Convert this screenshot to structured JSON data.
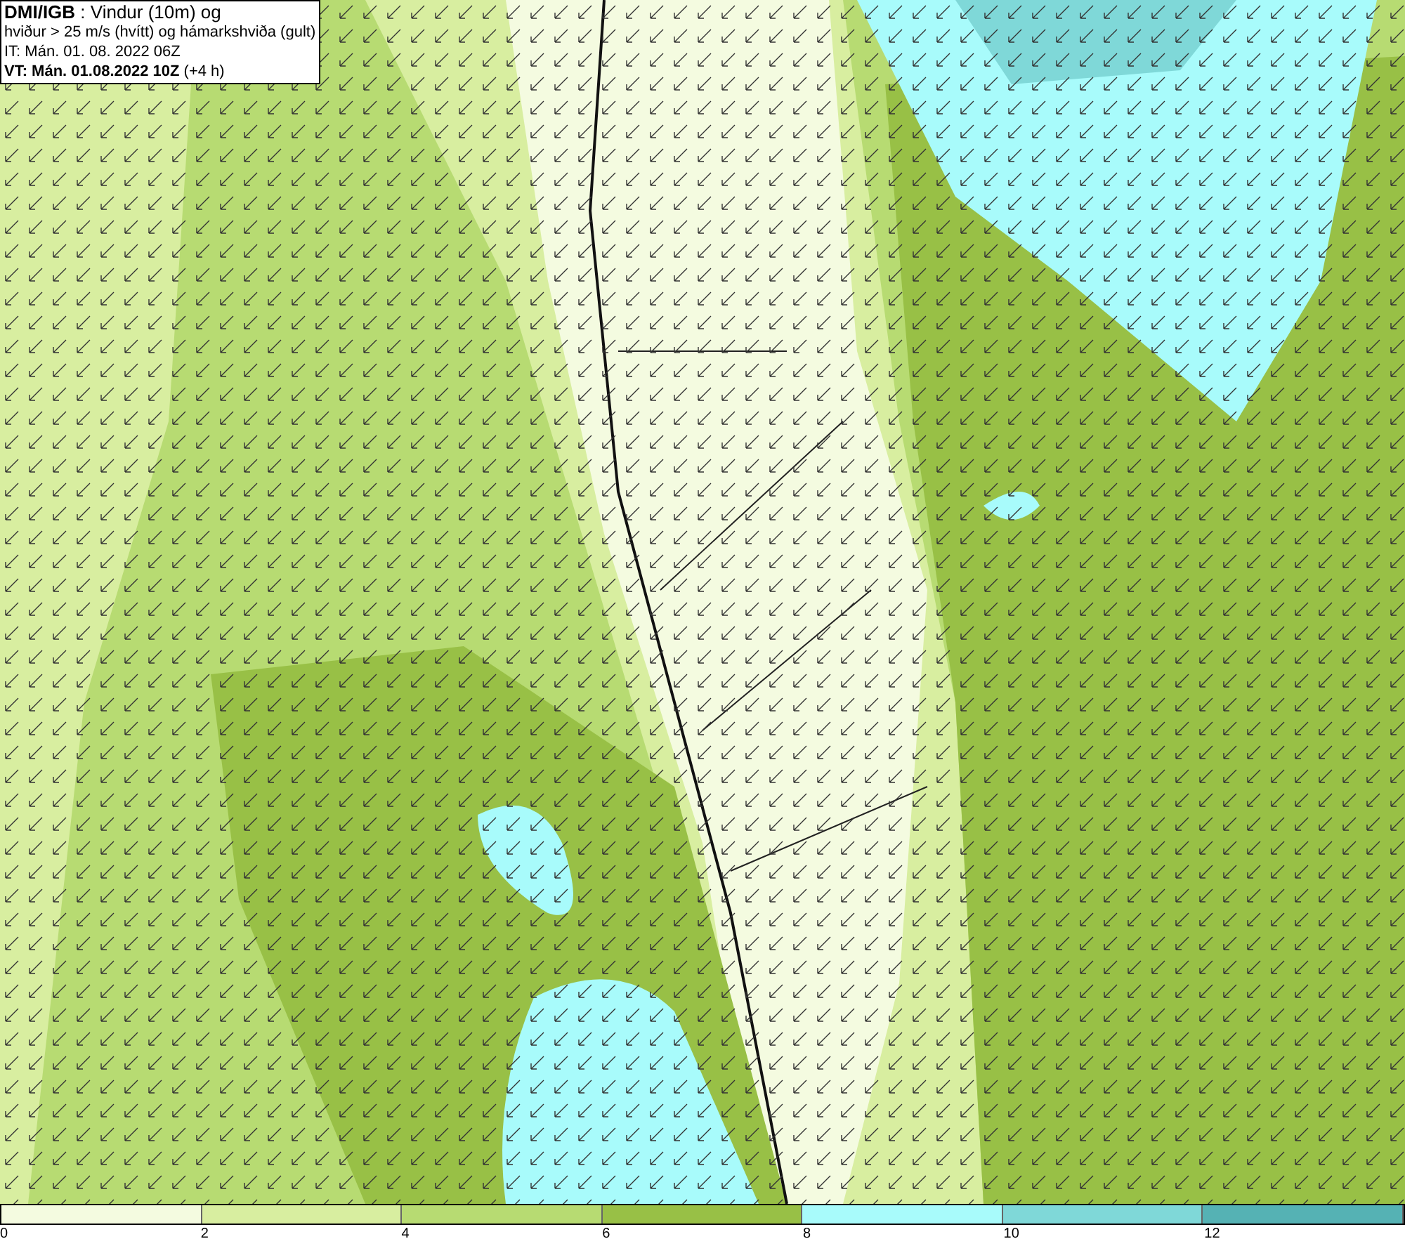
{
  "title_box": {
    "lines": [
      "**DMI/IGB** : Vindur (10m) og",
      "hviður > 25 m/s (hvítt) og hámarkshviða (gult)",
      "IT: Mán. 01. 08. 2022 06Z",
      "**VT: Mán. 01.08.2022 10Z** (+4 h)"
    ]
  },
  "legend": {
    "bins": [
      {
        "label": "0",
        "color": "#f4fbe0"
      },
      {
        "label": "2",
        "color": "#d8eea0"
      },
      {
        "label": "4",
        "color": "#b7db72"
      },
      {
        "label": "6",
        "color": "#98c046"
      },
      {
        "label": "8",
        "color": "#a8fbfb"
      },
      {
        "label": "10",
        "color": "#7fd8d8"
      },
      {
        "label": "12",
        "color": "#55b2b4"
      }
    ]
  }
}
